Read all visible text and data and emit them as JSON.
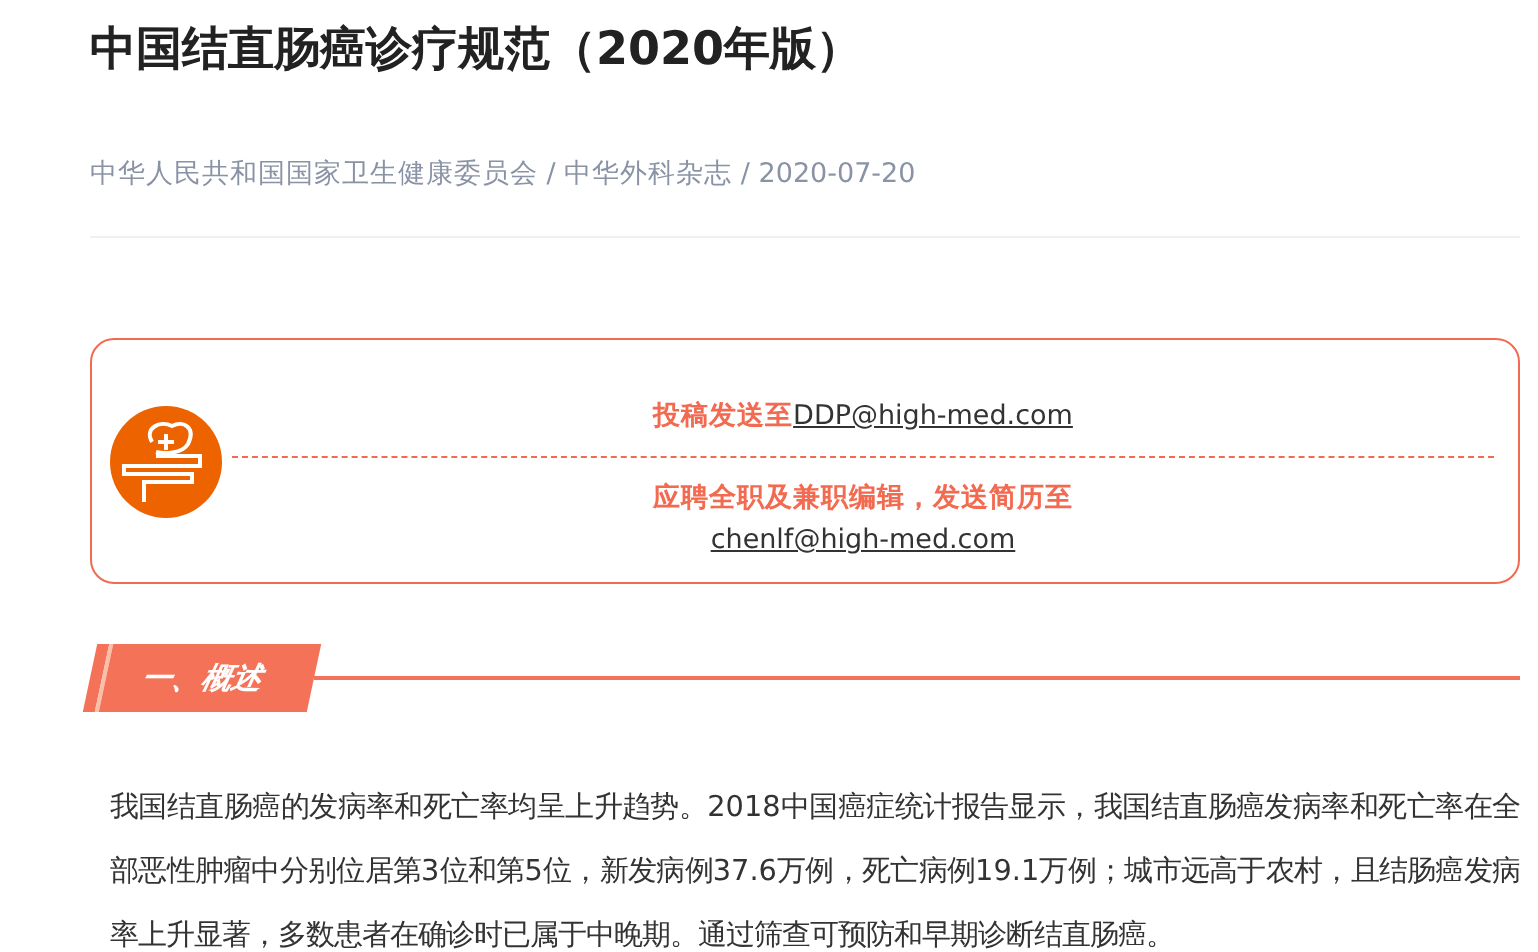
{
  "article": {
    "title": "中国结直肠癌诊疗规范（2020年版）",
    "meta": "中华人民共和国国家卫生健康委员会 / 中华外科杂志 / 2020-07-20"
  },
  "notice": {
    "submit_label": "投稿发送至",
    "submit_email": "DDP@high-med.com",
    "jobs_label": "应聘全职及兼职编辑，发送简历至",
    "jobs_email": "chenlf@high-med.com"
  },
  "section": {
    "heading": "一、概述",
    "paragraph": "我国结直肠癌的发病率和死亡率均呈上升趋势。2018中国癌症统计报告显示，我国结直肠癌发病率和死亡率在全部恶性肿瘤中分别位居第3位和第5位，新发病例37.6万例，死亡病例19.1万例；城市远高于农村，且结肠癌发病率上升显著，多数患者在确诊时已属于中晚期。通过筛查可预防和早期诊断结直肠癌。"
  }
}
